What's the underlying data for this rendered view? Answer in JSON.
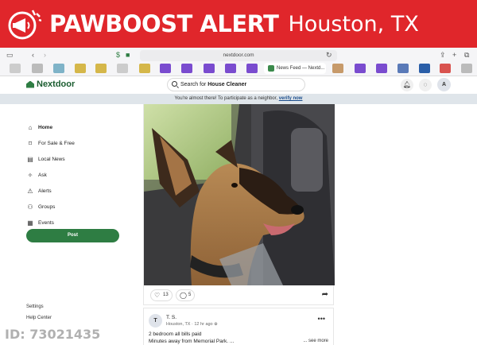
{
  "banner": {
    "brand": "PAWBOOST ALERT",
    "location": "Houston, TX",
    "color": "#e0262b"
  },
  "browser": {
    "url": "nextdoor.com",
    "active_tab": "News Feed — Nextd..."
  },
  "header": {
    "logo": "Nextdoor",
    "search_prefix": "Search for ",
    "search_term": "House Cleaner",
    "avatar": "A",
    "icons": [
      "bell-icon",
      "chat-icon"
    ]
  },
  "notice": {
    "text": "You're almost there! To participate as a neighbor,",
    "link": "verify now"
  },
  "sidebar": {
    "items": [
      {
        "label": "Home",
        "icon": "home-icon"
      },
      {
        "label": "For Sale & Free",
        "icon": "tag-icon"
      },
      {
        "label": "Local News",
        "icon": "news-icon"
      },
      {
        "label": "Ask",
        "icon": "sparkle-icon"
      },
      {
        "label": "Alerts",
        "icon": "alert-icon"
      },
      {
        "label": "Groups",
        "icon": "groups-icon"
      },
      {
        "label": "Events",
        "icon": "calendar-icon"
      }
    ],
    "post_button": "Post",
    "settings": "Settings",
    "help": "Help Center"
  },
  "post1": {
    "likes": "13",
    "comments": "5"
  },
  "post2": {
    "avatar": "T",
    "author": "T. S.",
    "location": "Houston, TX",
    "time": "12 hr ago",
    "line1": "2 bedroom all bills paid",
    "line2": "Minutes away from Memorial Park. ...",
    "see_more": "... see more"
  },
  "watermark": "ID: 73021435",
  "colors": {
    "brand_green": "#2e7d43",
    "notice_bg": "#dfe5ea"
  }
}
